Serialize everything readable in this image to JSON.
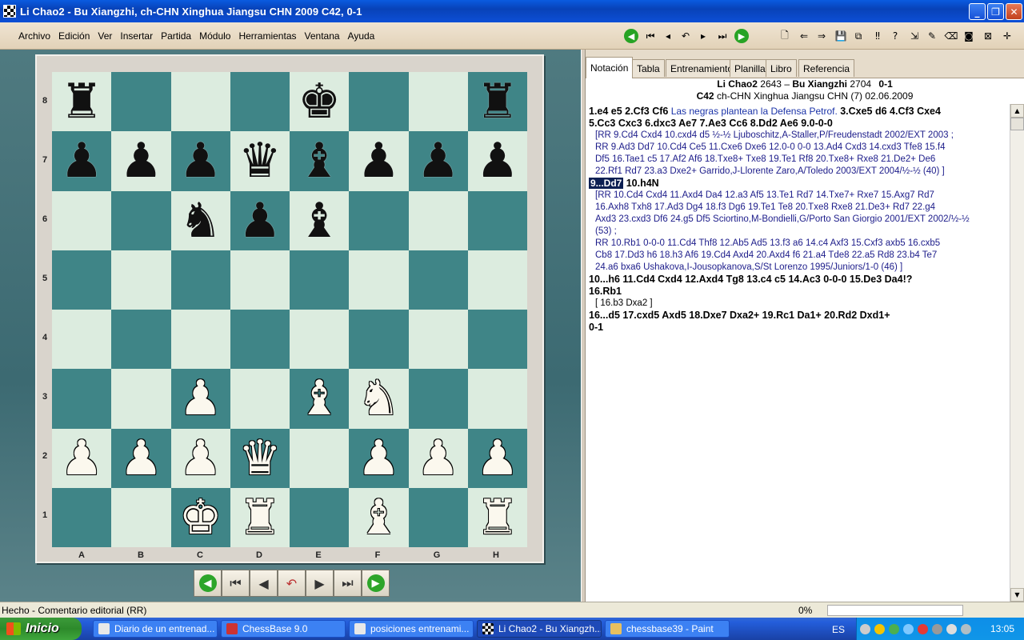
{
  "window": {
    "title": "Li Chao2 - Bu Xiangzhi, ch-CHN Xinghua Jiangsu CHN 2009  C42, 0-1"
  },
  "menu": [
    "Archivo",
    "Edición",
    "Ver",
    "Insertar",
    "Partida",
    "Módulo",
    "Herramientas",
    "Ventana",
    "Ayuda"
  ],
  "board": {
    "ranks": [
      "8",
      "7",
      "6",
      "5",
      "4",
      "3",
      "2",
      "1"
    ],
    "files": [
      "A",
      "B",
      "C",
      "D",
      "E",
      "F",
      "G",
      "H"
    ],
    "rows": [
      [
        "♜",
        "",
        "",
        "",
        "♚",
        "",
        "",
        "♜"
      ],
      [
        "♟",
        "♟",
        "♟",
        "♛",
        "♝",
        "♟",
        "♟",
        "♟"
      ],
      [
        "",
        "",
        "♞",
        "♟",
        "♝",
        "",
        "",
        ""
      ],
      [
        "",
        "",
        "",
        "",
        "",
        "",
        "",
        ""
      ],
      [
        "",
        "",
        "",
        "",
        "",
        "",
        "",
        ""
      ],
      [
        "",
        "",
        "♙",
        "",
        "♗",
        "♘",
        "",
        ""
      ],
      [
        "♙",
        "♙",
        "♙",
        "♕",
        "",
        "♙",
        "♙",
        "♙"
      ],
      [
        "",
        "",
        "♔",
        "♖",
        "",
        "♗",
        "",
        "♖"
      ]
    ]
  },
  "tabs": [
    "Notación",
    "Tabla",
    "Entrenamiento",
    "Planilla",
    "Libro",
    "Referencia"
  ],
  "header": {
    "white": "Li Chao2",
    "white_elo": "2643",
    "sep": "–",
    "black": "Bu Xiangzhi",
    "black_elo": "2704",
    "result": "0-1",
    "eco": "C42",
    "event": "ch-CHN Xinghua Jiangsu CHN (7) 02.06.2009"
  },
  "notation": {
    "l1": "1.e4  e5  2.Cf3  Cf6",
    "l1c": "Las negras plantean la Defensa Petrof.",
    "l1b": "3.Cxe5  d6  4.Cf3  Cxe4",
    "l2": "5.Cc3  Cxc3  6.dxc3  Ae7  7.Ae3  Cc6  8.Dd2  Ae6  9.0-0-0",
    "v1a": "[RR  9.Cd4  Cxd4  10.cxd4  d5 ½-½ Ljuboschitz,A-Staller,P/Freudenstadt 2002/EXT 2003 ;",
    "v1b": "RR 9.Ad3  Dd7  10.Cd4  Ce5  11.Cxe6  Dxe6  12.0-0  0-0  13.Ad4  Cxd3  14.cxd3  Tfe8  15.f4",
    "v1c": "Df5  16.Tae1  c5  17.Af2  Af6  18.Txe8+  Txe8  19.Te1  Rf8  20.Txe8+  Rxe8  21.De2+  De6",
    "v1d": "22.Rf1  Rd7  23.a3  Dxe2+ Garrido,J-Llorente Zaro,A/Toledo 2003/EXT 2004/½-½ (40) ]",
    "hl": "9...Dd7",
    "hlnext": "10.h4N",
    "v2a": "[RR  10.Cd4  Cxd4  11.Axd4  Da4  12.a3  Af5  13.Te1  Rd7  14.Txe7+  Rxe7  15.Axg7  Rd7",
    "v2b": "16.Axh8  Txh8  17.Ad3  Dg4  18.f3  Dg6  19.Te1  Te8  20.Txe8  Rxe8  21.De3+  Rd7  22.g4",
    "v2c": "Axd3  23.cxd3  Df6  24.g5  Df5 Sciortino,M-Bondielli,G/Porto San Giorgio 2001/EXT 2002/½-½",
    "v2d": "(53) ;",
    "v2e": "RR 10.Rb1  0-0-0  11.Cd4  Thf8  12.Ab5  Ad5  13.f3  a6  14.c4  Axf3  15.Cxf3  axb5  16.cxb5",
    "v2f": "Cb8  17.Dd3  h6  18.h3  Af6  19.Cd4  Axd4  20.Axd4  f6  21.a4  Tde8  22.a5  Rd8  23.b4  Te7",
    "v2g": "24.a6  bxa6 Ushakova,I-Jousopkanova,S/St Lorenzo 1995/Juniors/1-0 (46) ]",
    "l3": "10...h6  11.Cd4  Cxd4  12.Axd4  Tg8  13.c4  c5  14.Ac3  0-0-0  15.De3  Da4!?",
    "l4": "16.Rb1",
    "v3": "[ 16.b3  Dxa2 ]",
    "l5": "16...d5  17.cxd5  Axd5  18.Dxe7  Dxa2+  19.Rc1  Da1+  20.Rd2  Dxd1+",
    "l6": "0-1"
  },
  "status": {
    "text": "Hecho - Comentario editorial (RR)",
    "percent": "0%"
  },
  "taskbar": {
    "start": "Inicio",
    "tasks": [
      "Diario de un entrenad...",
      "ChessBase 9.0",
      "posiciones entrenami...",
      "Li Chao2 - Bu Xiangzh...",
      "chessbase39 - Paint"
    ],
    "lang": "ES",
    "clock": "13:05"
  }
}
